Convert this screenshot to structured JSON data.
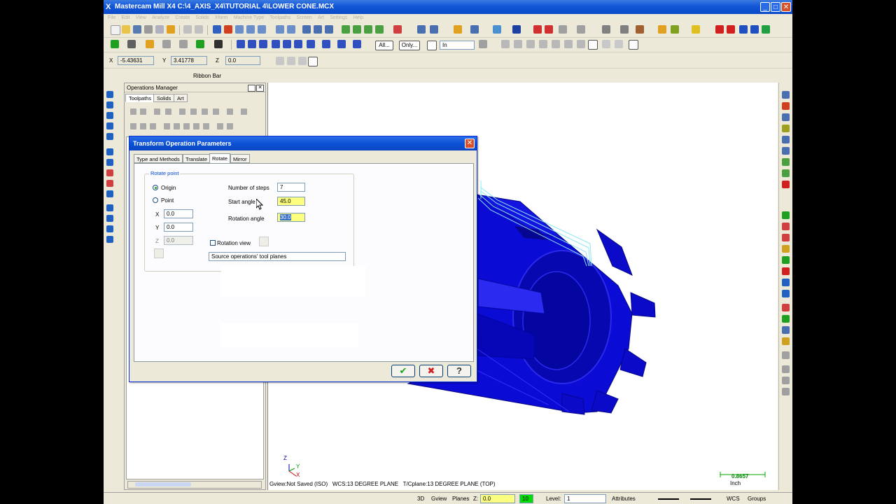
{
  "window": {
    "title": "Mastercam Mill X4  C:\\4_AXIS_X4\\TUTORIAL 4\\LOWER CONE.MCX",
    "minimize": "_",
    "maximize": "□",
    "close": "✕"
  },
  "menu": [
    "File",
    "Edit",
    "View",
    "Analyze",
    "Create",
    "Solids",
    "Xform",
    "Machine Type",
    "Toolpaths",
    "Screen",
    "Art",
    "Settings",
    "Help"
  ],
  "toolbar3": {
    "all_button": "All...",
    "only_button": "Only...",
    "mode_value": "In"
  },
  "coords": {
    "x_label": "X",
    "x_value": "-5.43631",
    "y_label": "Y",
    "y_value": "3.41778",
    "z_label": "Z",
    "z_value": "0.0"
  },
  "ribbon_label": "Ribbon Bar",
  "ops_manager": {
    "title": "Operations Manager",
    "tabs": [
      "Toolpaths",
      "Solids",
      "Art"
    ]
  },
  "dialog": {
    "title": "Transform Operation Parameters",
    "tabs": [
      "Type and Methods",
      "Translate",
      "Rotate",
      "Mirror"
    ],
    "group_label": "Rotate point",
    "origin_label": "Origin",
    "point_label": "Point",
    "x_label": "X",
    "x_value": "0.0",
    "y_label": "Y",
    "y_value": "0.0",
    "z_label": "Z",
    "z_value": "0.0",
    "steps_label": "Number of steps",
    "steps_value": "7",
    "start_label": "Start angle",
    "start_value": "45.0",
    "rotation_label": "Rotation angle",
    "rotation_value": "30.0",
    "rotation_view_label": "Rotation view",
    "source_label": "Source operations' tool planes",
    "ok": "✔",
    "cancel": "✖",
    "help": "?"
  },
  "viewport": {
    "gview": "Gview:Not Saved (ISO)",
    "wcs": "WCS:13 DEGREE PLANE",
    "tplane": "T/Cplane:13 DEGREE PLANE (TOP)",
    "scale_value": "0.8657",
    "scale_unit": "Inch",
    "axis_z": "Z",
    "axis_y": "Y",
    "axis_x": "X"
  },
  "statusbar": {
    "mode": "3D",
    "gview": "Gview",
    "planes": "Planes",
    "z_label": "Z:",
    "z_value": "0.0",
    "color_value": "10",
    "level_label": "Level:",
    "level_value": "1",
    "attributes": "Attributes",
    "wcs": "WCS",
    "groups": "Groups"
  },
  "colors": {
    "part_blue": "#0b0bd6",
    "titlebar_blue": "#1256d8",
    "highlight_yellow": "#ffff80"
  }
}
